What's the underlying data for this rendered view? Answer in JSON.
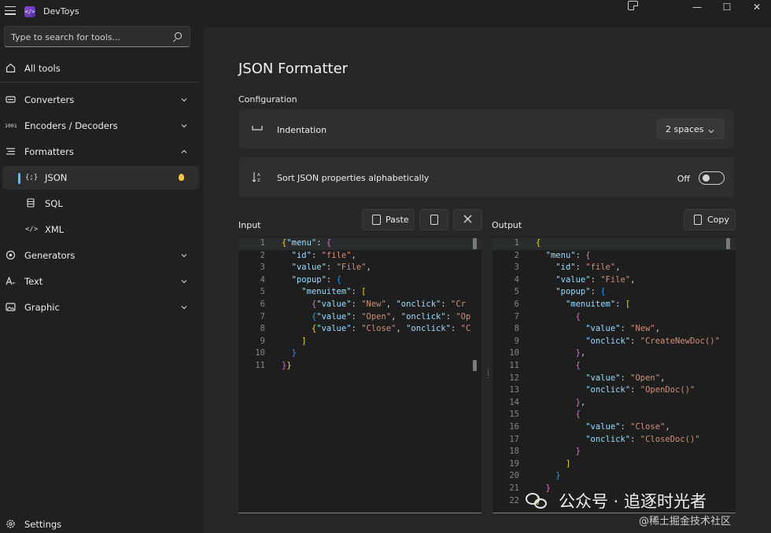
{
  "window": {
    "app_title": "DevToys",
    "minimize_glyph": "—",
    "maximize_glyph": "☐",
    "close_glyph": "✕"
  },
  "sidebar": {
    "search_placeholder": "Type to search for tools...",
    "items": [
      {
        "label": "All tools",
        "icon": "home-icon"
      },
      {
        "label": "Converters",
        "icon": "converters-icon",
        "expandable": true
      },
      {
        "label": "Encoders / Decoders",
        "icon": "encoders-icon",
        "expandable": true
      },
      {
        "label": "Formatters",
        "icon": "formatters-icon",
        "expanded": true
      },
      {
        "label": "JSON",
        "icon": "json-icon",
        "selected": true
      },
      {
        "label": "SQL",
        "icon": "sql-icon"
      },
      {
        "label": "XML",
        "icon": "xml-icon"
      },
      {
        "label": "Generators",
        "icon": "generators-icon",
        "expandable": true
      },
      {
        "label": "Text",
        "icon": "text-icon",
        "expandable": true
      },
      {
        "label": "Graphic",
        "icon": "graphic-icon",
        "expandable": true
      }
    ],
    "settings_label": "Settings"
  },
  "main": {
    "title": "JSON Formatter",
    "configuration_label": "Configuration",
    "indentation": {
      "label": "Indentation",
      "value": "2 spaces"
    },
    "sort": {
      "label": "Sort JSON properties alphabetically",
      "state_label": "Off",
      "enabled": false
    },
    "input": {
      "label": "Input",
      "paste_label": "Paste",
      "lines": [
        "{\"menu\": {",
        "  \"id\": \"file\",",
        "  \"value\": \"File\",",
        "  \"popup\": {",
        "    \"menuitem\": [",
        "      {\"value\": \"New\", \"onclick\": \"Cr",
        "      {\"value\": \"Open\", \"onclick\": \"Op",
        "      {\"value\": \"Close\", \"onclick\": \"C",
        "    ]",
        "  }",
        "}}"
      ]
    },
    "output": {
      "label": "Output",
      "copy_label": "Copy",
      "lines": [
        "{",
        "  \"menu\": {",
        "    \"id\": \"file\",",
        "    \"value\": \"File\",",
        "    \"popup\": {",
        "      \"menuitem\": [",
        "        {",
        "          \"value\": \"New\",",
        "          \"onclick\": \"CreateNewDoc()\"",
        "        },",
        "        {",
        "          \"value\": \"Open\",",
        "          \"onclick\": \"OpenDoc()\"",
        "        },",
        "        {",
        "          \"value\": \"Close\",",
        "          \"onclick\": \"CloseDoc()\"",
        "        }",
        "      ]",
        "    }",
        "  }",
        "}"
      ]
    }
  },
  "watermark": {
    "text": "公众号 · 追逐时光者",
    "subtext": "@稀土掘金技术社区"
  },
  "colors": {
    "accent": "#4cc2ff",
    "background": "#202020",
    "panel": "#272727",
    "card": "#2f2f2f",
    "editor": "#1e1e1e"
  }
}
